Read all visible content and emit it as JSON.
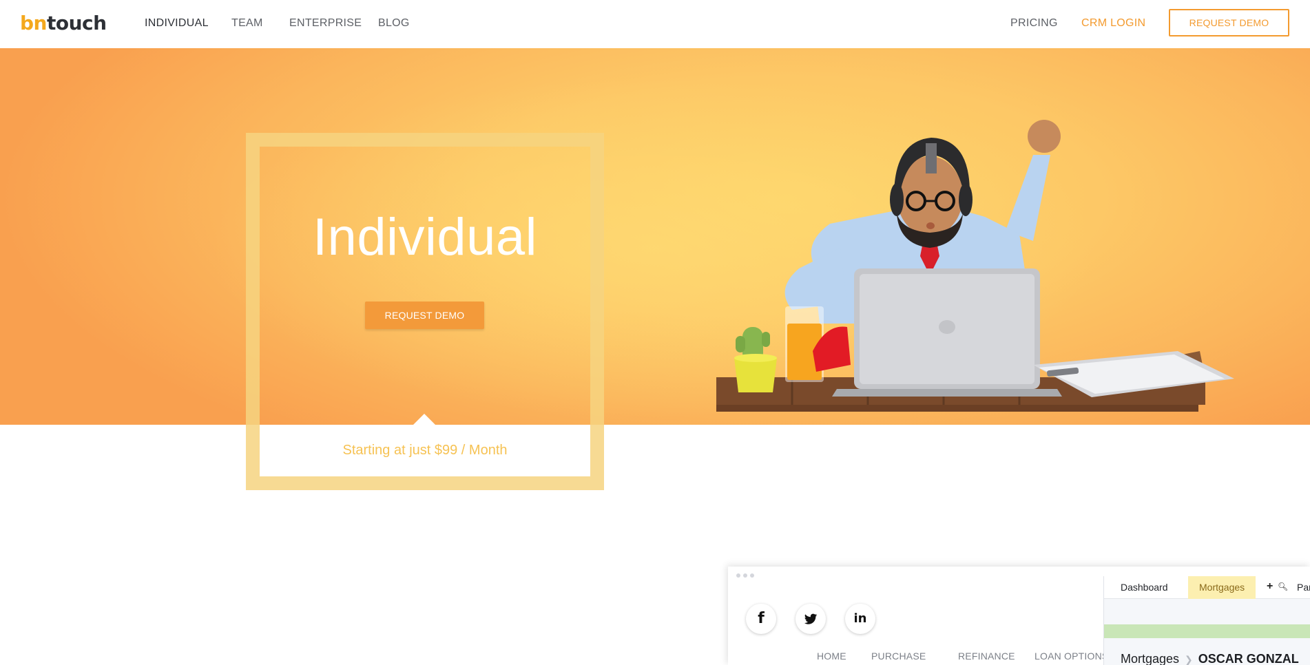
{
  "nav": {
    "logo_a": "bn",
    "logo_b": "touch",
    "links": [
      "INDIVIDUAL",
      "TEAM",
      "ENTERPRISE",
      "BLOG"
    ],
    "pricing": "PRICING",
    "crm_login": "CRM LOGIN",
    "request_demo": "REQUEST DEMO"
  },
  "hero": {
    "title": "Individual",
    "request_demo": "REQUEST DEMO",
    "price": "Starting at just $99 / Month"
  },
  "mockup": {
    "social_icons": [
      "facebook-icon",
      "twitter-icon",
      "linkedin-icon"
    ],
    "social_glyphs": [
      "f",
      "t",
      "in"
    ],
    "site_nav": [
      "HOME",
      "PURCHASE",
      "REFINANCE",
      "LOAN OPTIONS"
    ],
    "crm_tabs": [
      "Dashboard",
      "Mortgages",
      "Par"
    ],
    "crm_breadcrumb": {
      "section": "Mortgages",
      "contact": "OSCAR GONZAL"
    }
  },
  "colors": {
    "accent": "#f39a2e",
    "logo_orange": "#f4a81d",
    "hero_yellow": "#fdd36a",
    "price_text": "#f6c253"
  }
}
